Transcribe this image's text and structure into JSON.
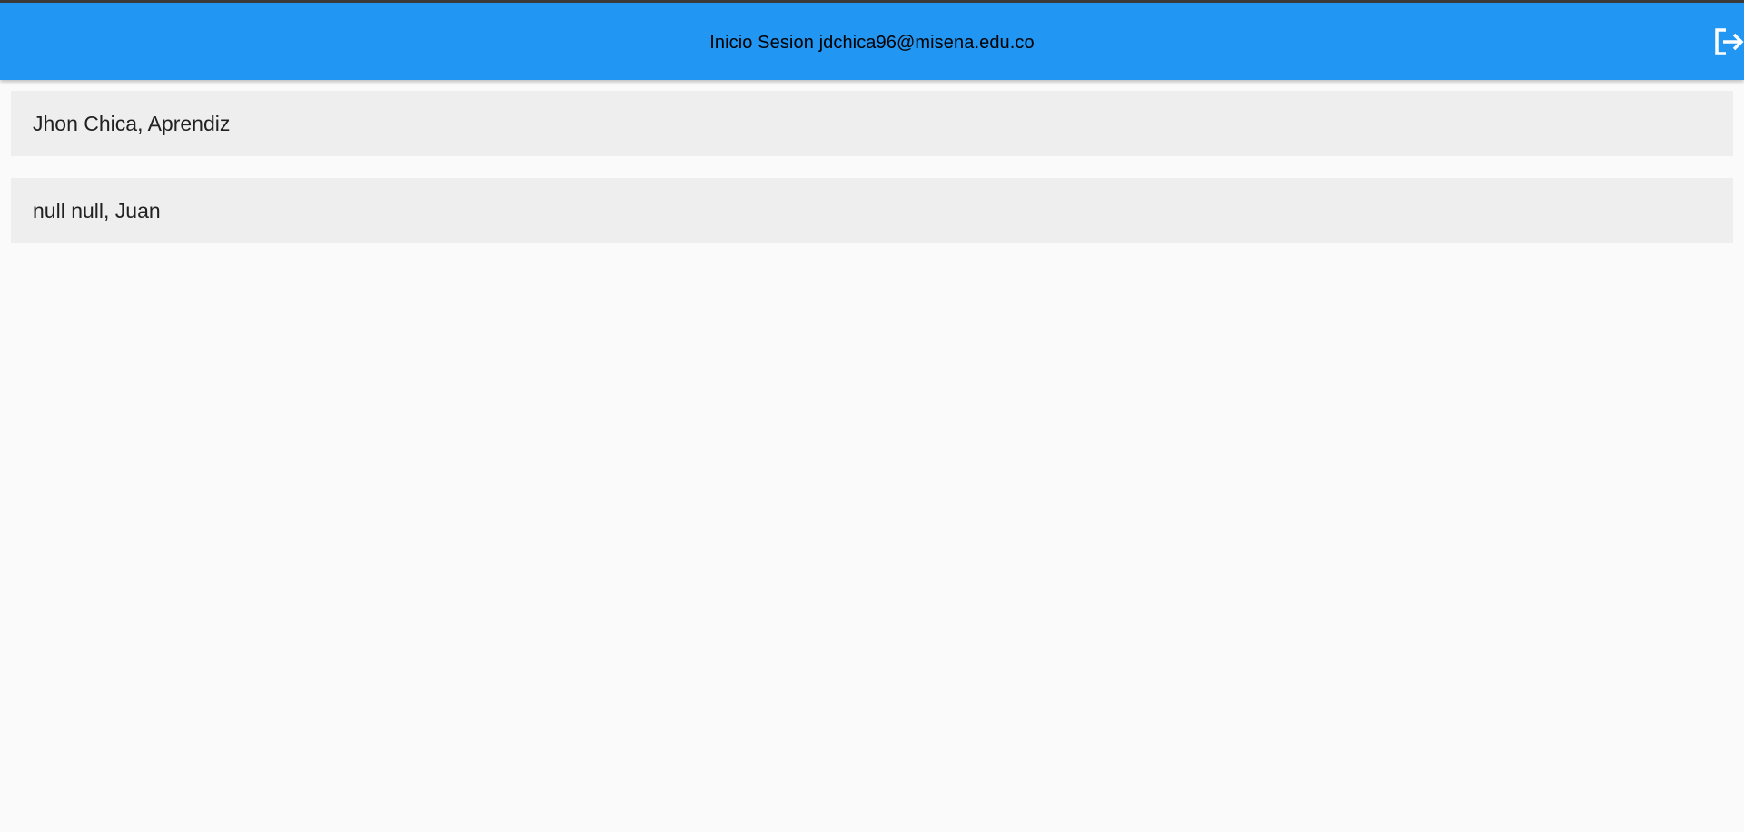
{
  "app_bar": {
    "title": "Inicio Sesion jdchica96@misena.edu.co",
    "background_color": "#2196f3",
    "action_icon": "logout-icon"
  },
  "list": {
    "items": [
      {
        "label": "Jhon Chica, Aprendiz"
      },
      {
        "label": "null null, Juan"
      }
    ],
    "item_background": "#eeeeee"
  }
}
